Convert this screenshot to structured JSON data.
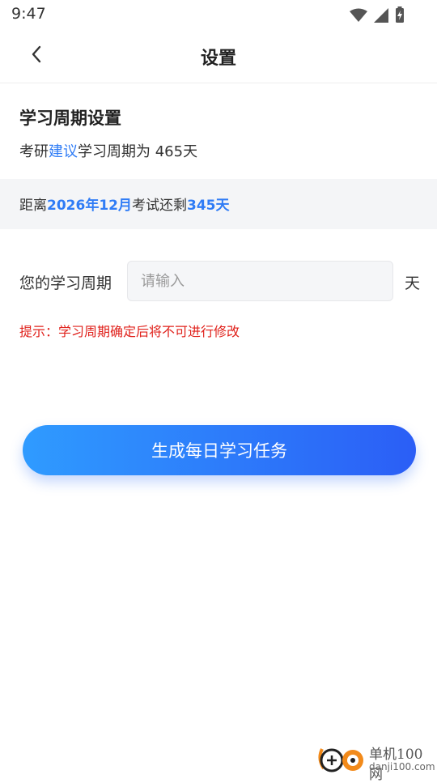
{
  "status_bar": {
    "time": "9:47",
    "icons": [
      "wifi-icon",
      "signal-icon",
      "battery-charging-icon"
    ]
  },
  "header": {
    "back_icon": "chevron-left-icon",
    "title": "设置"
  },
  "study_cycle": {
    "section_title": "学习周期设置",
    "suggest_prefix": "考研",
    "suggest_link": "建议",
    "suggest_suffix": "学习周期为 465天"
  },
  "countdown": {
    "prefix": "距离",
    "exam_date": "2026年12月",
    "middle": "考试还剩",
    "days_left": "345天"
  },
  "form": {
    "label": "您的学习周期",
    "input_value": "",
    "input_placeholder": "请输入",
    "unit": "天",
    "hint": "提示：学习周期确定后将不可进行修改"
  },
  "primary_button": {
    "label": "生成每日学习任务"
  },
  "watermark": {
    "cn": "单机100网",
    "en": "danji100.com"
  },
  "colors": {
    "accent_blue": "#2f7cf6",
    "hint_red": "#e0211b",
    "button_gradient_start": "#2f9bff",
    "button_gradient_end": "#2b5ef6"
  }
}
